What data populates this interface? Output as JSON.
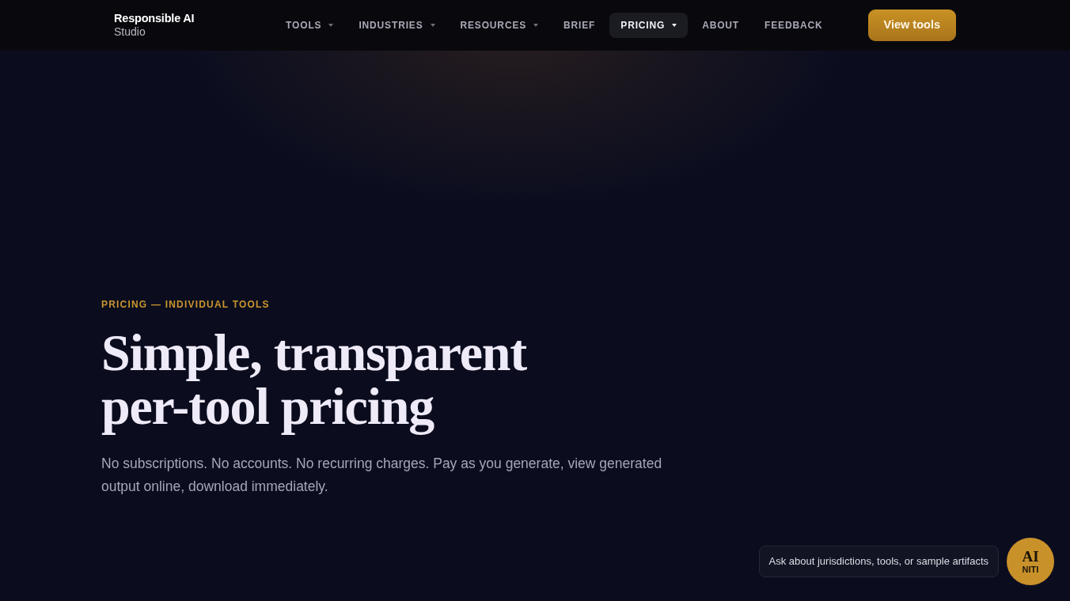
{
  "nav": {
    "brand": {
      "name": "Responsible AI",
      "sub": "Studio"
    },
    "items": [
      {
        "label": "TOOLS",
        "has_menu": true,
        "selected": false
      },
      {
        "label": "INDUSTRIES",
        "has_menu": true,
        "selected": false
      },
      {
        "label": "RESOURCES",
        "has_menu": true,
        "selected": false
      },
      {
        "label": "BRIEF",
        "has_menu": false,
        "selected": false
      },
      {
        "label": "PRICING",
        "has_menu": true,
        "selected": true
      },
      {
        "label": "ABOUT",
        "has_menu": false,
        "selected": false
      },
      {
        "label": "FEEDBACK",
        "has_menu": false,
        "selected": false
      }
    ],
    "cta": "View tools"
  },
  "hero": {
    "eyebrow": "PRICING — INDIVIDUAL TOOLS",
    "title": "Simple, transparent per-tool pricing",
    "lede": "No subscriptions. No accounts. No recurring charges. Pay as you generate, view generated output online, download immediately."
  },
  "assistant": {
    "hint": "Ask about jurisdictions, tools, or sample artifacts",
    "button": {
      "label": "AI",
      "sublabel": "NITI"
    }
  }
}
